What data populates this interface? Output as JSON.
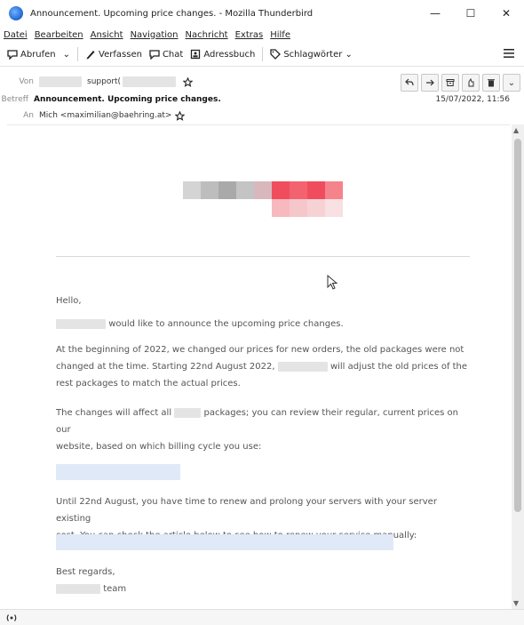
{
  "window": {
    "title": "Announcement. Upcoming price changes. - Mozilla Thunderbird",
    "controls": {
      "minimize": "—",
      "maximize": "☐",
      "close": "✕"
    }
  },
  "menu": [
    "Datei",
    "Bearbeiten",
    "Ansicht",
    "Navigation",
    "Nachricht",
    "Extras",
    "Hilfe"
  ],
  "toolbar": {
    "get_mail": "Abrufen",
    "dropdown": "⌄",
    "compose": "Verfassen",
    "chat": "Chat",
    "address_book": "Adressbuch",
    "tags": "Schlagwörter ⌄",
    "menu_icon": "hamburger-icon"
  },
  "header": {
    "from_label": "Von",
    "from_value": "support(",
    "subject_label": "Betreff",
    "subject": "Announcement. Upcoming price changes.",
    "date": "15/07/2022, 11:56",
    "to_label": "An",
    "to_value": "Mich <maximilian@baehring.at>"
  },
  "actions": [
    "reply",
    "forward",
    "archive",
    "junk",
    "delete",
    "more"
  ],
  "email": {
    "greeting": "Hello,",
    "intro": "would like to announce the upcoming price changes.",
    "para1_line1": "At the beginning of 2022, we changed our prices for new orders, the old packages were not",
    "para1_line2a": "changed at the time. Starting 22nd August 2022,",
    "para1_line2b": "will adjust the old prices of the",
    "para1_line3": "rest packages to match the actual prices.",
    "para2_line1a": "The changes will affect all",
    "para2_line1b": "packages; you can review their regular, current prices on our",
    "para2_line2": "website, based on which billing cycle you use:",
    "para3_line1": "Until 22nd August, you have time to renew and prolong your servers with your server existing",
    "para3_line2": "cost. You can check the article below to see how to renew your service manually:",
    "closing": "Best regards,",
    "team": "team"
  },
  "colors": {
    "logo_gray": [
      "#d4d4d4",
      "#bdbdbd",
      "#a9a9a9",
      "#c4c4c4",
      "#d8b8bc"
    ],
    "logo_red": [
      "#ef4d5e",
      "#f2636f",
      "#f5838c"
    ],
    "blur_link": "#dfe9f8"
  }
}
